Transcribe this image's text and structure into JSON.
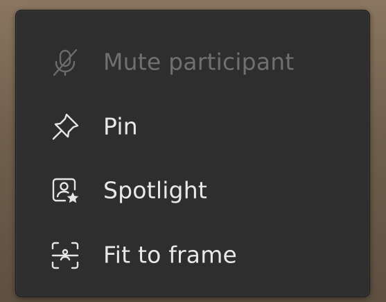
{
  "context_menu": {
    "items": [
      {
        "label": "Mute participant",
        "icon": "microphone-off-icon",
        "enabled": false
      },
      {
        "label": "Pin",
        "icon": "pin-icon",
        "enabled": true
      },
      {
        "label": "Spotlight",
        "icon": "spotlight-icon",
        "enabled": true
      },
      {
        "label": "Fit to frame",
        "icon": "fit-to-frame-icon",
        "enabled": true
      }
    ]
  },
  "colors": {
    "menu_background": "#2e2e2e",
    "text": "#e9e9e9",
    "disabled_text": "#707070"
  }
}
